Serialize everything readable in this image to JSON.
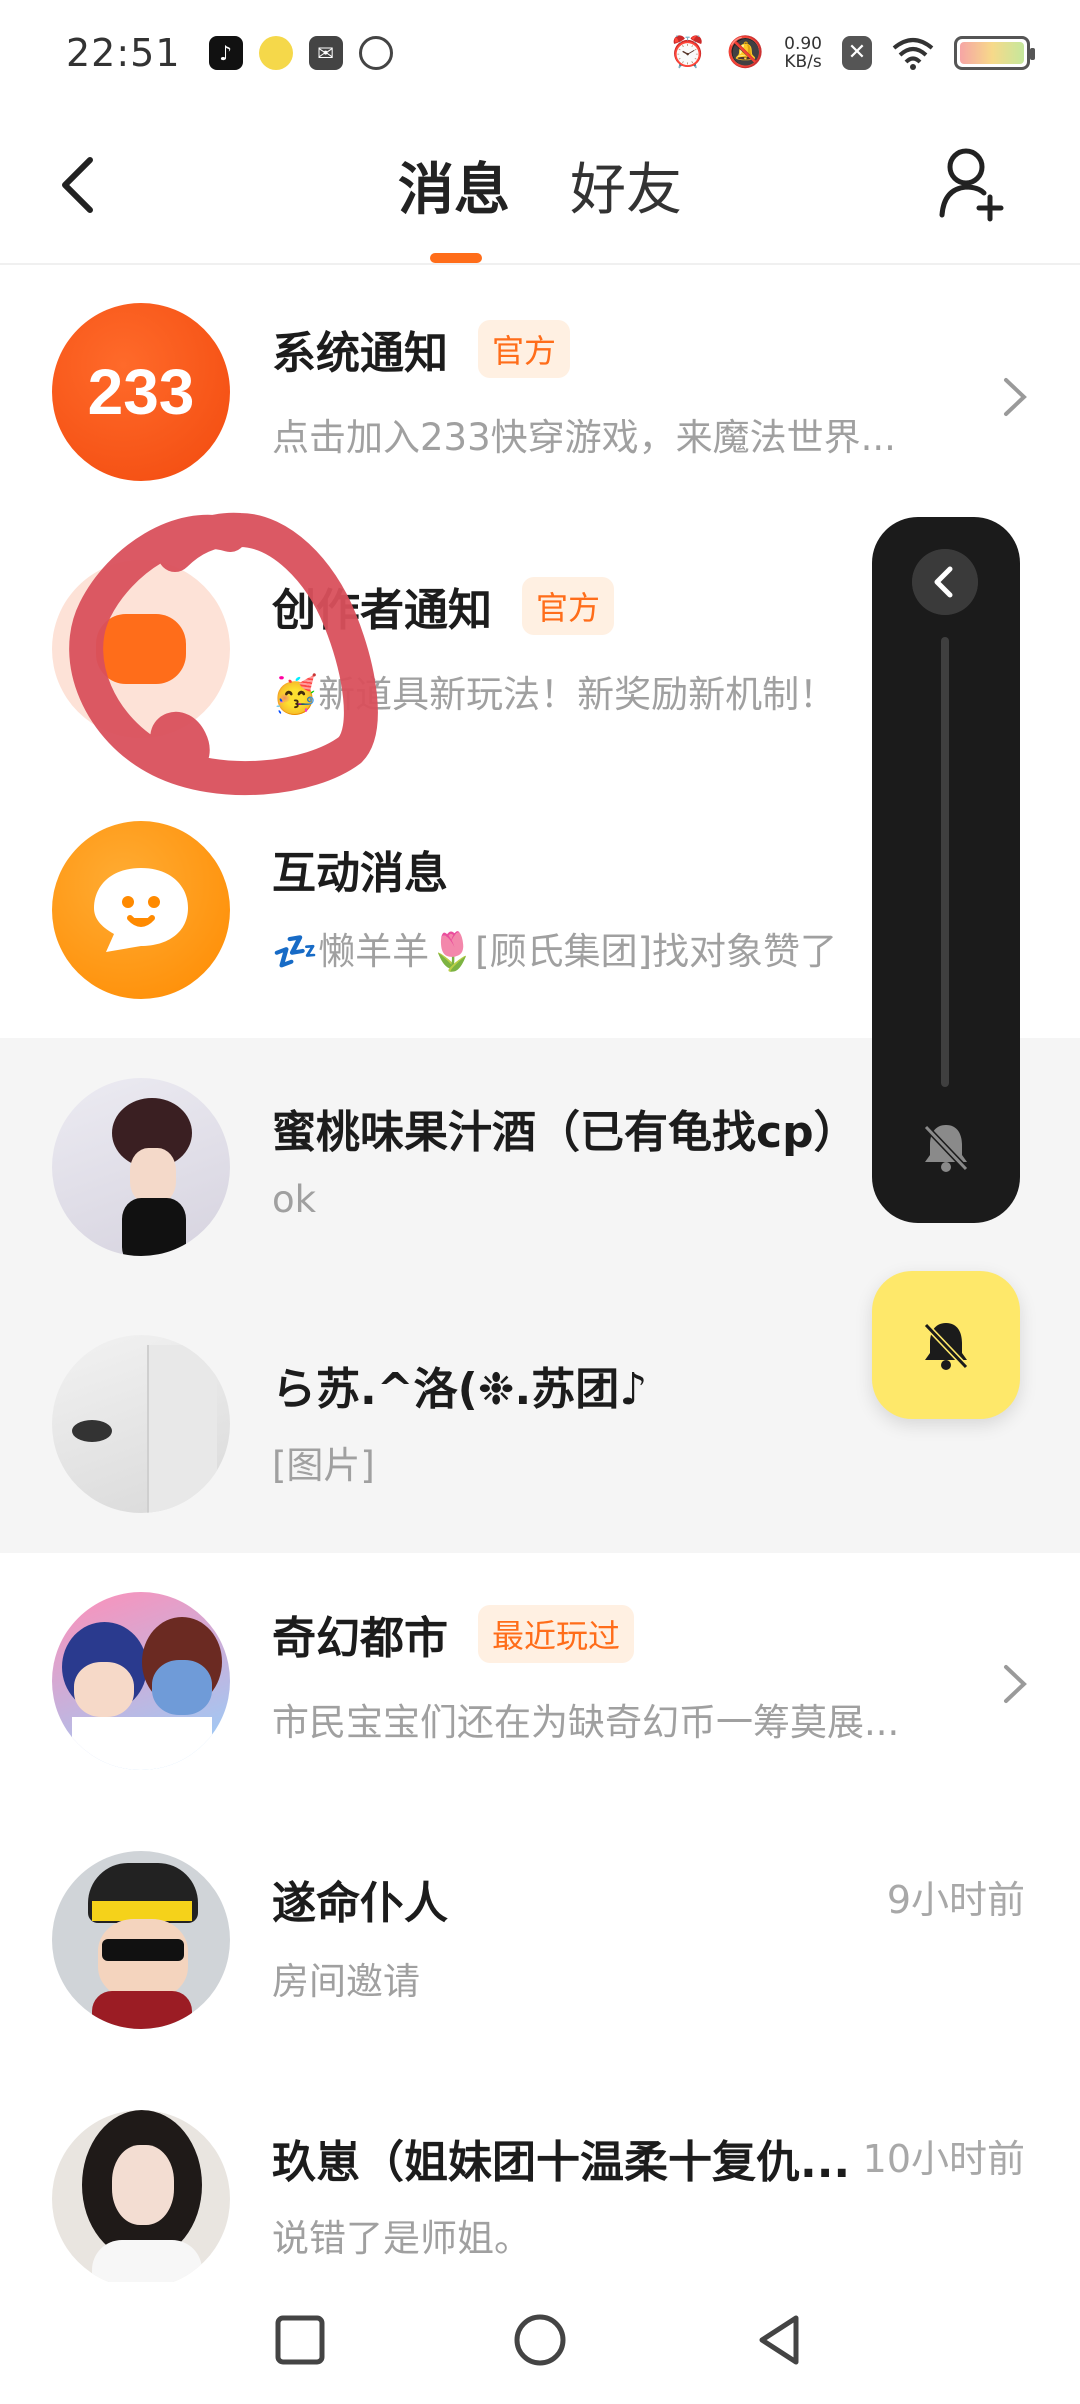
{
  "status_bar": {
    "time": "22:51",
    "net_speed_value": "0.90",
    "net_speed_unit": "KB/s",
    "icons": [
      "tiktok-icon",
      "app-icon",
      "mail-icon",
      "link-icon",
      "alarm-icon",
      "mute-icon",
      "sim-off-icon",
      "wifi-icon",
      "battery-icon"
    ]
  },
  "header": {
    "tab_messages": "消息",
    "tab_friends": "好友"
  },
  "list": [
    {
      "title": "系统通知",
      "badge": "官方",
      "subtitle": "点击加入233快穿游戏，来魔法世界...",
      "avatar_text": "233"
    },
    {
      "title": "创作者通知",
      "badge": "官方",
      "subtitle": "🥳新道具新玩法！新奖励新机制！"
    },
    {
      "title": "互动消息",
      "subtitle": "💤懒羊羊🌷[顾氏集团]找对象赞了"
    },
    {
      "title": "蜜桃味果汁酒（已有龟找cp）",
      "subtitle": "ok"
    },
    {
      "title": "ら苏.^洛(❉.苏团♪",
      "subtitle": "[图片]"
    },
    {
      "title": "奇幻都市",
      "badge": "最近玩过",
      "subtitle": "市民宝宝们还在为缺奇幻币一筹莫展..."
    },
    {
      "title": "遂命仆人",
      "subtitle": "房间邀请",
      "time": "9小时前"
    },
    {
      "title": "玖崽（姐妹团十温柔十复仇...",
      "subtitle": "说错了是师姐。",
      "time": "10小时前"
    }
  ],
  "colors": {
    "accent": "#ff6d1a",
    "badge_bg": "#fff0e2",
    "mute_fab": "#fee86a",
    "panel": "#1b1b1b",
    "scribble": "#d9505c"
  }
}
